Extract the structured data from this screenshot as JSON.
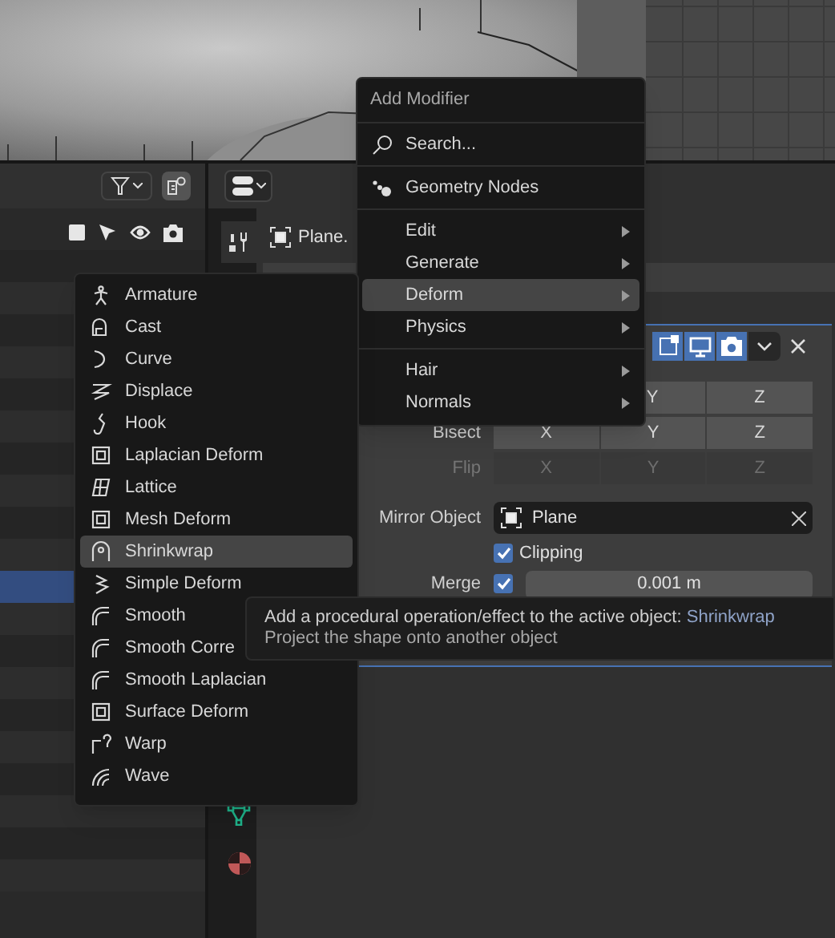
{
  "outliner": {
    "rows": [
      {
        "selected": false
      },
      {
        "selected": false
      },
      {
        "selected": false
      },
      {
        "selected": false
      },
      {
        "selected": false
      },
      {
        "selected": false
      },
      {
        "selected": false
      },
      {
        "selected": false
      },
      {
        "selected": false
      },
      {
        "selected": false
      },
      {
        "selected": true
      },
      {
        "selected": false
      },
      {
        "selected": false
      },
      {
        "selected": false
      },
      {
        "selected": false
      },
      {
        "selected": false
      },
      {
        "selected": false
      },
      {
        "selected": false
      },
      {
        "selected": false
      },
      {
        "selected": false
      }
    ]
  },
  "properties": {
    "tabs": [
      {
        "kind": "modifier",
        "selected": true
      },
      {
        "kind": "mesh",
        "selected": false
      },
      {
        "kind": "material",
        "selected": false
      }
    ],
    "object_name": "Plane.",
    "panel_toggles": [
      {
        "kind": "edit",
        "on": true
      },
      {
        "kind": "viewport",
        "on": true
      },
      {
        "kind": "render",
        "on": true
      }
    ],
    "axis_rows": [
      {
        "label": "",
        "disabled": false,
        "buttons": [
          "Y",
          "Z"
        ]
      },
      {
        "label": "Bisect",
        "disabled": false,
        "buttons": [
          "X",
          "Y",
          "Z"
        ]
      },
      {
        "label": "Flip",
        "disabled": true,
        "buttons": [
          "X",
          "Y",
          "Z"
        ]
      }
    ],
    "mirror_object": {
      "label": "Mirror Object",
      "value": "Plane"
    },
    "clipping": {
      "label": "Clipping",
      "checked": true
    },
    "merge": {
      "label": "Merge",
      "checked": true,
      "value": "0.001 m"
    }
  },
  "add_modifier_menu": {
    "title": "Add Modifier",
    "sections": [
      [
        {
          "kind": "search",
          "label": "Search...",
          "selected": false
        }
      ],
      [
        {
          "kind": "nodes",
          "label": "Geometry Nodes",
          "selected": false
        }
      ],
      [
        {
          "kind": "submenu",
          "label": "Edit",
          "selected": false
        },
        {
          "kind": "submenu",
          "label": "Generate",
          "selected": false
        },
        {
          "kind": "submenu",
          "label": "Deform",
          "selected": true
        },
        {
          "kind": "submenu",
          "label": "Physics",
          "selected": false
        }
      ],
      [
        {
          "kind": "submenu",
          "label": "Hair",
          "selected": false
        },
        {
          "kind": "submenu",
          "label": "Normals",
          "selected": false
        }
      ]
    ]
  },
  "deform_menu": {
    "items": [
      {
        "label": "Armature",
        "selected": false
      },
      {
        "label": "Cast",
        "selected": false
      },
      {
        "label": "Curve",
        "selected": false
      },
      {
        "label": "Displace",
        "selected": false
      },
      {
        "label": "Hook",
        "selected": false
      },
      {
        "label": "Laplacian Deform",
        "selected": false
      },
      {
        "label": "Lattice",
        "selected": false
      },
      {
        "label": "Mesh Deform",
        "selected": false
      },
      {
        "label": "Shrinkwrap",
        "selected": true
      },
      {
        "label": "Simple Deform",
        "selected": false
      },
      {
        "label": "Smooth",
        "selected": false
      },
      {
        "label": "Smooth Corre",
        "selected": false
      },
      {
        "label": "Smooth Laplacian",
        "selected": false
      },
      {
        "label": "Surface Deform",
        "selected": false
      },
      {
        "label": "Warp",
        "selected": false
      },
      {
        "label": "Wave",
        "selected": false
      }
    ]
  },
  "tooltip": {
    "text": "Add a procedural operation/effect to the active object:",
    "target": "Shrinkwrap",
    "description": "Project the shape onto another object"
  }
}
